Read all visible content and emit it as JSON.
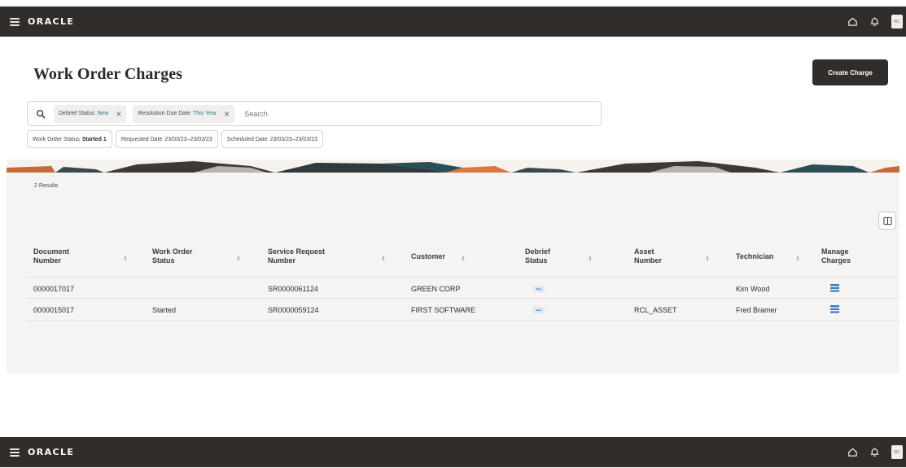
{
  "header": {
    "logo": "ORACLE",
    "avatar_initials": "RC"
  },
  "page": {
    "title": "Work Order Charges",
    "create_label": "Create Charge"
  },
  "search": {
    "filters": [
      {
        "label": "Debrief Status",
        "value": "New"
      },
      {
        "label": "Resolution Due Date",
        "value": "This Year"
      }
    ],
    "placeholder": "Search"
  },
  "chips": [
    {
      "label": "Work Order Status",
      "value": "Started 1"
    },
    {
      "label": "Requested Date",
      "value": "23/03/23–23/03/23"
    },
    {
      "label": "Scheduled Date",
      "value": "23/03/23–23/03/23"
    }
  ],
  "results_text": "2 Results",
  "table": {
    "columns": [
      {
        "line1": "Document",
        "line2": "Number"
      },
      {
        "line1": "Work Order",
        "line2": "Status"
      },
      {
        "line1": "Service Request",
        "line2": "Number"
      },
      {
        "line1": "Customer",
        "line2": ""
      },
      {
        "line1": "Debrief",
        "line2": "Status"
      },
      {
        "line1": "Asset",
        "line2": "Number"
      },
      {
        "line1": "Technician",
        "line2": ""
      },
      {
        "line1": "Manage",
        "line2": "Charges"
      }
    ],
    "rows": [
      {
        "doc": "0000017017",
        "wo_status": "",
        "sr": "SR0000061124",
        "customer": "GREEN CORP",
        "debrief": "New",
        "asset": "",
        "technician": "Kim Wood"
      },
      {
        "doc": "0000015017",
        "wo_status": "Started",
        "sr": "SR0000059124",
        "customer": "FIRST SOFTWARE",
        "debrief": "New",
        "asset": "RCL_ASSET",
        "technician": "Fred Bramer"
      }
    ]
  },
  "colors": {
    "topbar": "#312d2a",
    "accent": "#2f7a8f",
    "manage_icon": "#3a7bbf"
  },
  "icons": [
    "hamburger-icon",
    "home-icon",
    "bell-icon",
    "search-icon",
    "close-icon",
    "sort-icon",
    "columns-icon",
    "manage-charges-icon"
  ]
}
